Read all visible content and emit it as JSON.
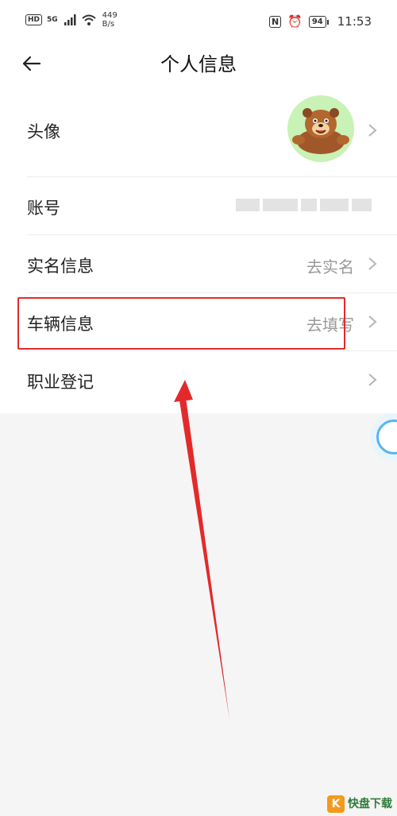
{
  "status_bar": {
    "hd": "HD",
    "network": "5G",
    "speed_value": "449",
    "speed_unit": "B/s",
    "nfc": "N",
    "battery": "94",
    "time": "11:53"
  },
  "header": {
    "title": "个人信息",
    "back_icon": "back-arrow-icon"
  },
  "rows": [
    {
      "label": "头像",
      "value": "",
      "has_avatar": true
    },
    {
      "label": "账号",
      "value": ""
    },
    {
      "label": "实名信息",
      "value": "去实名"
    },
    {
      "label": "车辆信息",
      "value": "去填写"
    },
    {
      "label": "职业登记",
      "value": ""
    }
  ],
  "annotation": {
    "color": "#e32a2a"
  },
  "watermark": {
    "main": "快盘下载",
    "logo": "K"
  }
}
